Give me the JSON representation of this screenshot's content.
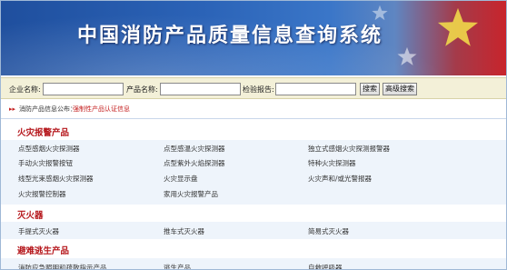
{
  "banner": {
    "title": "中国消防产品质量信息查询系统"
  },
  "search": {
    "company_label": "企业名称:",
    "product_label": "产品名称:",
    "report_label": "检验报告:",
    "company_value": "",
    "product_value": "",
    "report_value": "",
    "search_button": "搜索",
    "advanced_button": "高级搜索"
  },
  "breadcrumb": {
    "arrows": "▸▸",
    "root": "消防产品信息公布：",
    "current": "强制性产品认证信息"
  },
  "colors": {
    "banner_blue": "#2b63b7",
    "accent_red": "#b5161b",
    "band_blue": "#eef4fb"
  },
  "categories": [
    {
      "title": "火灾报警产品",
      "items": [
        "点型感烟火灾探测器",
        "点型感温火灾探测器",
        "独立式感烟火灾探测报警器",
        "手动火灾报警按钮",
        "点型紫外火焰探测器",
        "特种火灾探测器",
        "线型光束感烟火灾探测器",
        "火灾显示盘",
        "火灾声和/或光警报器",
        "火灾报警控制器",
        "家用火灾报警产品",
        ""
      ]
    },
    {
      "title": "灭火器",
      "items": [
        "手提式灭火器",
        "推车式灭火器",
        "简易式灭火器"
      ]
    },
    {
      "title": "避难逃生产品",
      "items": [
        "消防应急照明和疏散指示产品",
        "逃生产品",
        "自救呼吸器"
      ]
    }
  ]
}
